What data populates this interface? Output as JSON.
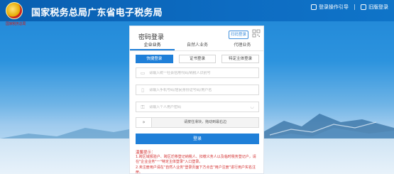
{
  "header": {
    "title": "国家税务总局广东省电子税务局",
    "emblem_text": "国家税务总局",
    "links": [
      {
        "label": "登录操作引导",
        "icon": "screen-icon"
      },
      {
        "label": "旧版登录",
        "icon": "login-icon"
      }
    ]
  },
  "panel": {
    "title": "密码登录",
    "scan_label": "扫码登录",
    "qr_icon": "qr-code-icon",
    "tabs": [
      "企业业务",
      "自然人业务",
      "代理业务"
    ],
    "active_tab": 0,
    "subtabs": [
      "快捷登录",
      "证书登录",
      "特定主体登录"
    ],
    "active_subtab": 0,
    "fields": {
      "credit_code_placeholder": "请输入统一社会信用代码/纳税人识别号",
      "account_placeholder": "请输入手机号码/居民身份证号码/用户名",
      "password_placeholder": "请输入个人用户密码"
    },
    "slider_text": "请按住滑块，拖动到最右边",
    "login_label": "登录",
    "tips_title": "温馨提示：",
    "tips": [
      "1.跨区域报验户、跨区迁移登记纳税人、扣缴义务人以及临时税务登记户，请在\"企业业务\"一\"特定主体登录\"入口登录。",
      "2.未注册用户请在\"自然人业务\"登录页面下方点击\"用户注册\"进行用户实名注册。"
    ]
  },
  "colors": {
    "brand_blue": "#1f7fd8",
    "header_blue": "#0a5fb0",
    "tip_red": "#d32f2f"
  }
}
